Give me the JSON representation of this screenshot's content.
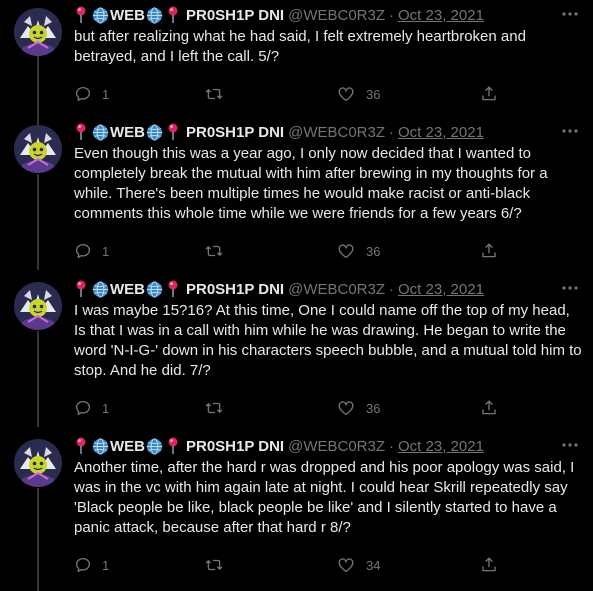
{
  "colors": {
    "background": "#000000",
    "text": "#e7e9ea",
    "muted": "#71767b",
    "pin": "#e0245e",
    "globe": "#3b88c3"
  },
  "author": {
    "display_name_text": "WEB",
    "display_name_suffix": "PR0SH1P DNI",
    "handle": "@WEBC0R3Z",
    "separator": "·",
    "date": "Oct 23, 2021"
  },
  "tweets": [
    {
      "text": "but after realizing what he had said, I felt extremely heartbroken and betrayed, and I left the call. 5/?",
      "replies": "1",
      "retweets": "",
      "likes": "36"
    },
    {
      "text": "Even though this was a year ago, I only now decided that I wanted to completely break the mutual with him after brewing in my thoughts for a while. There's been multiple times he would make racist or anti-black comments this whole time while we were friends for a few years 6/?",
      "replies": "1",
      "retweets": "",
      "likes": "36"
    },
    {
      "text": "I was maybe 15?16? At this time, One I could name off the top of my head, Is that I was in a call with him while he was drawing. He began to write the word 'N-I-G-' down in his characters speech bubble, and a mutual told him to stop. And he did. 7/?",
      "replies": "1",
      "retweets": "",
      "likes": "36"
    },
    {
      "text": "Another time, after the hard r was dropped and his poor apology was said, I was in the vc with him again late at night. I could hear Skrill repeatedly say 'Black people be like, black people be like' and I silently started to have a panic attack, because after that hard r 8/?",
      "replies": "1",
      "retweets": "",
      "likes": "34"
    }
  ]
}
